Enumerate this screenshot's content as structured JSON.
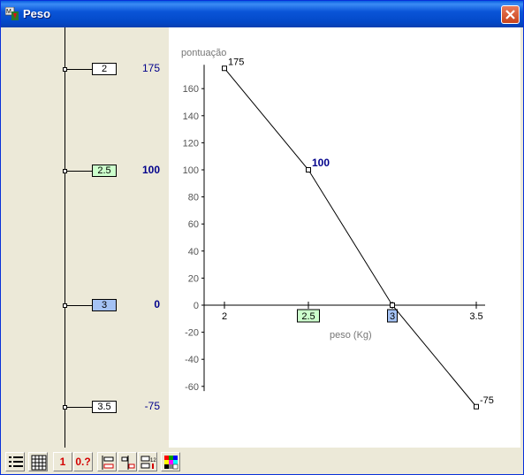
{
  "window": {
    "title": "Peso"
  },
  "scale": [
    {
      "value": "2",
      "score": "175",
      "highlight": "none",
      "bold": false
    },
    {
      "value": "2.5",
      "score": "100",
      "highlight": "green",
      "bold": true
    },
    {
      "value": "3",
      "score": "0",
      "highlight": "blue",
      "bold": true
    },
    {
      "value": "3.5",
      "score": "-75",
      "highlight": "none",
      "bold": false
    }
  ],
  "toolbar": {
    "one_label": "1",
    "decimal_label": "0.?"
  },
  "chart_data": {
    "type": "line",
    "ylabel": "pontuação",
    "xlabel": "peso (Kg)",
    "ylim": [
      -70,
      175
    ],
    "yticks": [
      160,
      140,
      120,
      100,
      80,
      60,
      40,
      20,
      0,
      -20,
      -40,
      -60
    ],
    "xticks": [
      "2",
      "2.5",
      "3",
      "3.5"
    ],
    "x": [
      2,
      2.5,
      3,
      3.5
    ],
    "y": [
      175,
      100,
      0,
      -75
    ],
    "point_labels": [
      "175",
      "100",
      "",
      "-75"
    ],
    "highlight_x": {
      "2.5": "#ccffcc",
      "3": "#a4c2f4"
    },
    "line_color": "#000000"
  }
}
